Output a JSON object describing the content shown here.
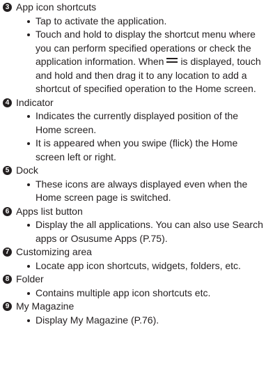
{
  "sections": [
    {
      "number": "3",
      "title": "App icon shortcuts",
      "bullets": [
        "Tap to activate the application.",
        {
          "before_icon": "Touch and hold to display the shortcut menu where you can perform specified operations or check the application information. When",
          "icon": "drag-handle-icon",
          "after_icon": "is displayed, touch and hold and then drag it to any location to add a shortcut of specified operation to the Home screen."
        }
      ]
    },
    {
      "number": "4",
      "title": "Indicator",
      "bullets": [
        "Indicates the currently displayed position of the Home screen.",
        "It is appeared when you swipe (flick) the Home screen left or right."
      ]
    },
    {
      "number": "5",
      "title": "Dock",
      "bullets": [
        "These icons are always displayed even when the Home screen page is switched."
      ]
    },
    {
      "number": "6",
      "title": "Apps list button",
      "bullets": [
        "Display the all applications. You can also use Search apps or Osusume Apps (P.75)."
      ]
    },
    {
      "number": "7",
      "title": "Customizing area",
      "bullets": [
        "Locate app icon shortcuts, widgets, folders, etc."
      ]
    },
    {
      "number": "8",
      "title": "Folder",
      "bullets": [
        "Contains multiple app icon shortcuts etc."
      ]
    },
    {
      "number": "9",
      "title": "My Magazine",
      "bullets": [
        "Display My Magazine (P.76)."
      ]
    }
  ]
}
